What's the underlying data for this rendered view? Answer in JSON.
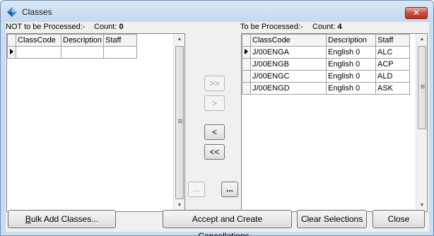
{
  "window": {
    "title": "Classes",
    "close_glyph": "✕",
    "icon": "diamond-app-icon"
  },
  "left": {
    "label": "NOT to be Processed:-",
    "count_label": "Count:",
    "count": "0",
    "columns": [
      "ClassCode",
      "Description",
      "Staff"
    ],
    "rows": []
  },
  "right": {
    "label": "To be Processed:-",
    "count_label": "Count:",
    "count": "4",
    "columns": [
      "ClassCode",
      "Description",
      "Staff"
    ],
    "rows": [
      [
        "J/00ENGA",
        "English 0",
        "ALC"
      ],
      [
        "J/00ENGB",
        "English 0",
        "ACP"
      ],
      [
        "J/00ENGC",
        "English 0",
        "ALD"
      ],
      [
        "J/00ENGD",
        "English 0",
        "ASK"
      ]
    ]
  },
  "transfer": {
    "move_all_right": ">>",
    "move_right": ">",
    "move_left": "<",
    "move_all_left": "<<",
    "left_ellipsis": "...",
    "right_ellipsis": "..."
  },
  "footer": {
    "bulk_add_u": "B",
    "bulk_add_rest": "ulk Add Classes...",
    "accept": "Accept and Create Cancellations...",
    "clear": "Clear Selections",
    "close": "Close"
  },
  "scroll": {
    "up_icon": "▲",
    "down_icon": "▼"
  }
}
